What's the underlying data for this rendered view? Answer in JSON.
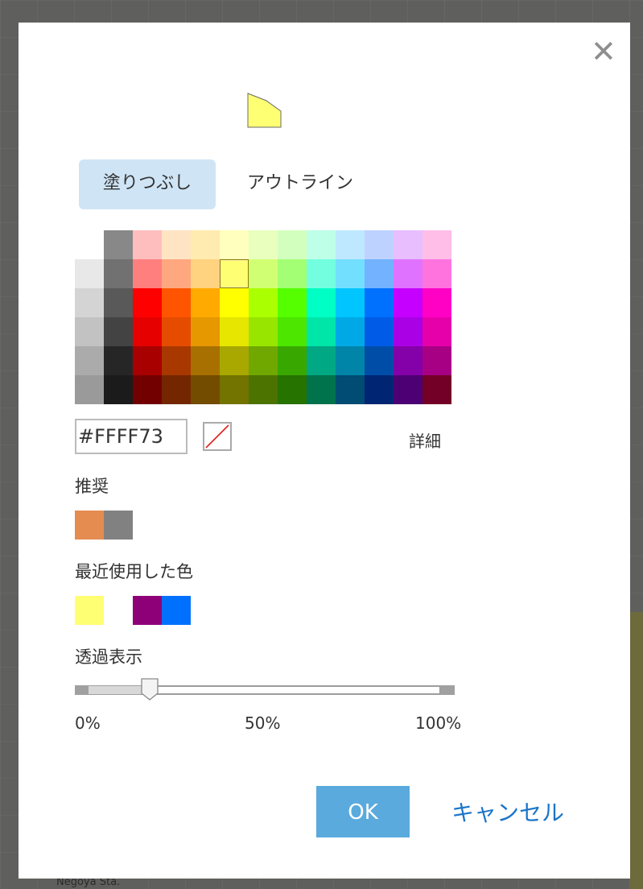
{
  "dialog": {
    "close_glyph": "✕",
    "preview_color": "#FFFF73",
    "tabs": [
      {
        "label": "塗りつぶし",
        "active": true
      },
      {
        "label": "アウトライン",
        "active": false
      }
    ],
    "palette": {
      "grays": [
        "#888888",
        "#E8E8E8",
        "#717171",
        "#D4D4D4",
        "#595959",
        "#C2C2C2",
        "#434343",
        "#ABABAB",
        "#262626",
        "#9A9A9A",
        "#1B1B1B"
      ],
      "rows": [
        [
          "#FFBEBE",
          "#FFE4C4",
          "#FFEBAF",
          "#FFFFBE",
          "#E9FFBE",
          "#D3FFBE",
          "#BEFFE8",
          "#BEE8FF",
          "#BED2FF",
          "#E8BEFF",
          "#FFBEE8"
        ],
        [
          "#FF7F7F",
          "#FFA77F",
          "#FFD37F",
          "#FFFF73",
          "#D1FF73",
          "#A3FF73",
          "#73FFDF",
          "#73DFFF",
          "#73B2FF",
          "#DF73FF",
          "#FF73DF"
        ],
        [
          "#FF0000",
          "#FF5500",
          "#FFAA00",
          "#FFFF00",
          "#AAFF00",
          "#55FF00",
          "#00FFC5",
          "#00C5FF",
          "#0070FF",
          "#C500FF",
          "#FF00C5"
        ],
        [
          "#E60000",
          "#E64C00",
          "#E69800",
          "#E6E600",
          "#98E600",
          "#4CE600",
          "#00E6A9",
          "#00A9E6",
          "#005CE6",
          "#A900E6",
          "#E600A9"
        ],
        [
          "#A80000",
          "#A83800",
          "#A87000",
          "#A8A800",
          "#70A800",
          "#38A800",
          "#00A884",
          "#0084A8",
          "#004DA8",
          "#8400A8",
          "#A80084"
        ],
        [
          "#730000",
          "#732600",
          "#734C00",
          "#737300",
          "#4C7300",
          "#267300",
          "#00734C",
          "#004C73",
          "#002673",
          "#4C0073",
          "#730026"
        ]
      ],
      "selected": "#FFFF73"
    },
    "hex_value": "#FFFF73",
    "detail_label": "詳細",
    "recommended": {
      "label": "推奨",
      "colors": [
        "#E58C51",
        "#818181"
      ]
    },
    "recent": {
      "label": "最近使用した色",
      "colors": [
        "#FFFF73",
        "#FFFFFF",
        "#8E0077",
        "#0070FF"
      ]
    },
    "transparency": {
      "label": "透過表示",
      "value": 0.17,
      "ticks": [
        "0%",
        "50%",
        "100%"
      ]
    },
    "buttons": {
      "ok": "OK",
      "cancel": "キャンセル"
    }
  },
  "map": {
    "label": "Negoya Sta."
  }
}
